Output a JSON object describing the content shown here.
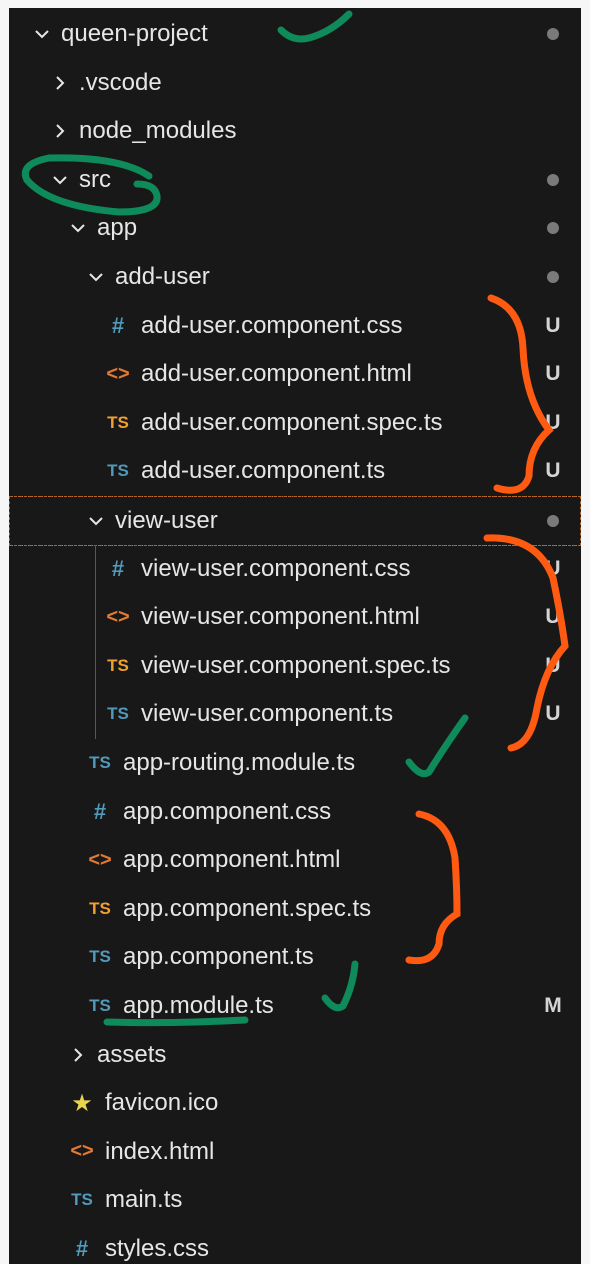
{
  "tree": [
    {
      "label": "queen-project",
      "depth": 0,
      "kind": "folder-open",
      "status": "dot"
    },
    {
      "label": ".vscode",
      "depth": 1,
      "kind": "folder-closed",
      "status": ""
    },
    {
      "label": "node_modules",
      "depth": 1,
      "kind": "folder-closed",
      "status": ""
    },
    {
      "label": "src",
      "depth": 1,
      "kind": "folder-open",
      "status": "dot"
    },
    {
      "label": "app",
      "depth": 2,
      "kind": "folder-open",
      "status": "dot"
    },
    {
      "label": "add-user",
      "depth": 3,
      "kind": "folder-open",
      "status": "dot"
    },
    {
      "label": "add-user.component.css",
      "depth": 4,
      "kind": "css",
      "status": "U"
    },
    {
      "label": "add-user.component.html",
      "depth": 4,
      "kind": "html",
      "status": "U"
    },
    {
      "label": "add-user.component.spec.ts",
      "depth": 4,
      "kind": "spec",
      "status": "U"
    },
    {
      "label": "add-user.component.ts",
      "depth": 4,
      "kind": "ts",
      "status": "U"
    },
    {
      "label": "view-user",
      "depth": 3,
      "kind": "folder-open",
      "status": "dot"
    },
    {
      "label": "view-user.component.css",
      "depth": 4,
      "kind": "css",
      "status": "U"
    },
    {
      "label": "view-user.component.html",
      "depth": 4,
      "kind": "html",
      "status": "U"
    },
    {
      "label": "view-user.component.spec.ts",
      "depth": 4,
      "kind": "spec",
      "status": "U"
    },
    {
      "label": "view-user.component.ts",
      "depth": 4,
      "kind": "ts",
      "status": "U"
    },
    {
      "label": "app-routing.module.ts",
      "depth": 3,
      "kind": "ts",
      "status": ""
    },
    {
      "label": "app.component.css",
      "depth": 3,
      "kind": "css",
      "status": ""
    },
    {
      "label": "app.component.html",
      "depth": 3,
      "kind": "html",
      "status": ""
    },
    {
      "label": "app.component.spec.ts",
      "depth": 3,
      "kind": "spec",
      "status": ""
    },
    {
      "label": "app.component.ts",
      "depth": 3,
      "kind": "ts",
      "status": ""
    },
    {
      "label": "app.module.ts",
      "depth": 3,
      "kind": "ts",
      "status": "M"
    },
    {
      "label": "assets",
      "depth": 2,
      "kind": "folder-closed",
      "status": ""
    },
    {
      "label": "favicon.ico",
      "depth": 2,
      "kind": "star",
      "status": ""
    },
    {
      "label": "index.html",
      "depth": 2,
      "kind": "html",
      "status": ""
    },
    {
      "label": "main.ts",
      "depth": 2,
      "kind": "ts",
      "status": ""
    },
    {
      "label": "styles.css",
      "depth": 2,
      "kind": "css",
      "status": ""
    }
  ],
  "icons": {
    "css": "#",
    "html": "<>",
    "spec": "TS",
    "ts": "TS",
    "star": "★"
  },
  "colors": {
    "background": "#181818",
    "text": "#e6e6e6",
    "annotation_green": "#0f8a5a",
    "annotation_orange": "#ff5a12"
  }
}
